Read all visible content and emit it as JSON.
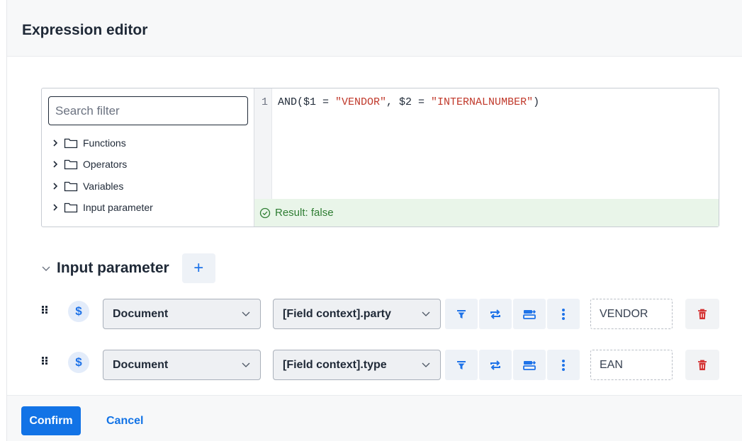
{
  "dialog": {
    "title": "Expression editor"
  },
  "tree": {
    "search_placeholder": "Search filter",
    "items": [
      {
        "label": "Functions",
        "icon": "folder-icon"
      },
      {
        "label": "Operators",
        "icon": "folder-icon"
      },
      {
        "label": "Variables",
        "icon": "folder-icon"
      },
      {
        "label": "Input parameter",
        "icon": "folder-icon"
      }
    ]
  },
  "code": {
    "line_number": "1",
    "plain_1": "AND($1 = ",
    "str_1": "\"VENDOR\"",
    "plain_2": ", $2 = ",
    "str_2": "\"INTERNALNUMBER\"",
    "plain_3": ")",
    "string_color": "#c0392b"
  },
  "result": {
    "text": "Result: false",
    "color": "#2e7d32"
  },
  "params": {
    "title": "Input parameter",
    "add_label": "+",
    "rows": [
      {
        "source": "Document",
        "field": "[Field context].party",
        "value": "VENDOR"
      },
      {
        "source": "Document",
        "field": "[Field context].type",
        "value": "EAN"
      }
    ],
    "row_icon": "$",
    "accent": "#1f73e8",
    "delete_color": "#d32f2f"
  },
  "footer": {
    "confirm_label": "Confirm",
    "cancel_label": "Cancel"
  }
}
